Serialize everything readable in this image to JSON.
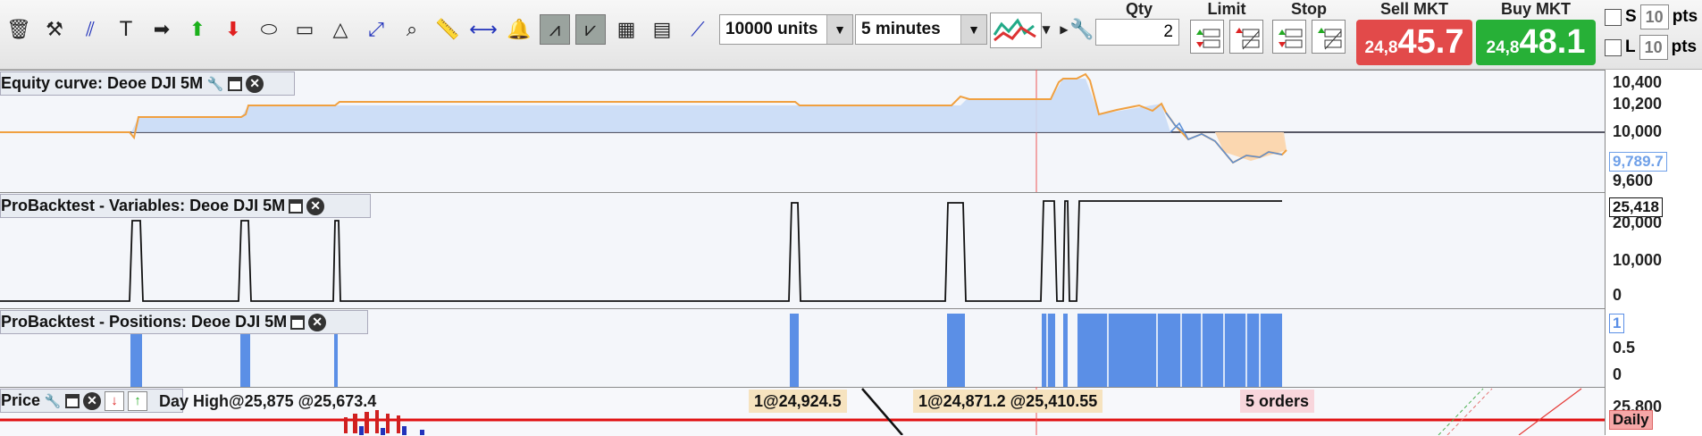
{
  "toolbar": {
    "icons": [
      "trash-icon",
      "tools-icon",
      "cross-lines-icon",
      "text-tool-icon",
      "arrow-right-icon",
      "green-up-arrow-icon",
      "red-down-arrow-icon",
      "ellipse-tool-icon",
      "rectangle-tool-icon",
      "triangle-tool-icon",
      "expand-icon",
      "magnifier-icon",
      "ruler-icon",
      "horizontal-line-icon",
      "alert-bell-icon",
      "indicator-red-icon",
      "indicator-green-icon",
      "grid-chart-icon",
      "grid-chart-2-icon",
      "trendline-icon"
    ],
    "units_select": "10000 units",
    "interval_select": "5 minutes",
    "qty_label": "Qty",
    "qty_value": "2",
    "limit_label": "Limit",
    "stop_label": "Stop",
    "sell_label": "Sell MKT",
    "buy_label": "Buy MKT",
    "sell_price_small": "24,8",
    "sell_price_big": "45.7",
    "buy_price_small": "24,8",
    "buy_price_big": "48.1",
    "sell_color": "#e24a4a",
    "buy_color": "#27b037",
    "s_label": "S",
    "s_value": "10",
    "l_label": "L",
    "l_value": "10",
    "pts_label": "pts"
  },
  "panels": {
    "equity": {
      "title": "Equity curve: Deoe DJI 5M",
      "ticks": [
        "10,400",
        "10,200",
        "10,000",
        "9,600"
      ],
      "current_value": "9,789.7"
    },
    "variables": {
      "title": "ProBacktest - Variables: Deoe DJI 5M",
      "ticks": [
        "20,000",
        "10,000",
        "0"
      ],
      "current_value": "25,418"
    },
    "positions": {
      "title": "ProBacktest - Positions: Deoe DJI 5M",
      "ticks": [
        "0.5",
        "0"
      ],
      "current_value": "1"
    },
    "price": {
      "title": "Price",
      "overlap_text": "Day High@25,875 @25,673.4",
      "tags": [
        "1@24,924.5",
        "1@24,871.2 @25,410.55",
        "5 orders"
      ],
      "tick_top": "25,800",
      "daily_label": "Daily"
    }
  }
}
